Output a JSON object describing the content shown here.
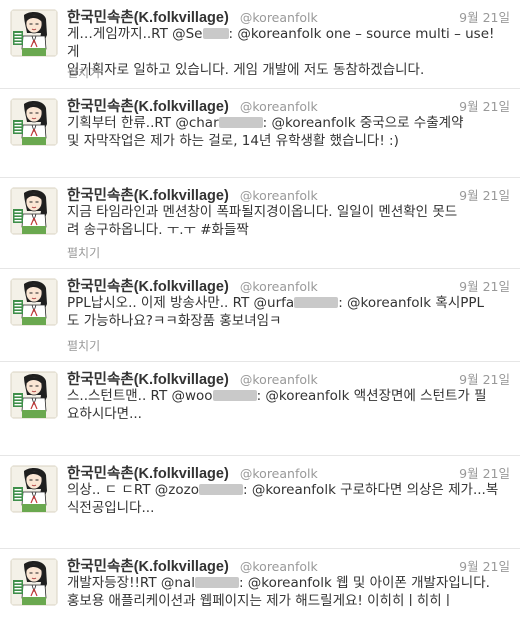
{
  "author": {
    "display_name": "한국민속촌(K.folkvillage)",
    "screen_name": "@koreanfolk",
    "avatar": "folk-village-character-avatar",
    "avatar_text": "한국민속촌"
  },
  "expand_label": "펼치기",
  "colors": {
    "text": "#333333",
    "muted": "#999999",
    "divider": "#e6e6e6",
    "redacted": "#c9c9c9"
  },
  "tweets": [
    {
      "time": "9월 21일",
      "line1": {
        "a": "게…게임까지..RT @Se",
        "b": ": @koreanfolk one – source multi – use! 게"
      },
      "line2": "임기획자로 일하고 있습니다. 게임 개발에 저도 동참하겠습니다."
    },
    {
      "time": "9월 21일",
      "line1": {
        "a": "기획부터 한류..RT @char",
        "b": ": @koreanfolk 중국으로 수출계약"
      },
      "line2": "및 자막작업은 제가 하는 걸로, 14년 유학생활 했습니다! :)"
    },
    {
      "time": "9월 21일",
      "line1": "지금 타임라인과 멘션창이 폭파될지경이옵니다. 일일이 멘션확인 못드",
      "line2": "려 송구하옵니다. ㅜ.ㅜ #화들짝"
    },
    {
      "time": "9월 21일",
      "line1": {
        "a": "PPL납시오.. 이제 방송사만.. RT @urfa",
        "b": ": @koreanfolk 혹시PPL"
      },
      "line2": "도 가능하나요?ㅋㅋ화장품 홍보녀임ㅋ"
    },
    {
      "time": "9월 21일",
      "line1": {
        "a": "스..스턴트맨.. RT @woo",
        "b": ": @koreanfolk 액션장면에 스턴트가 필"
      },
      "line2": "요하시다면..."
    },
    {
      "time": "9월 21일",
      "line1": {
        "a": "의상.. ㄷ ㄷRT @zozo",
        "b": ": @koreanfolk 구로하다면 의상은 제가...복"
      },
      "line2": "식전공입니다..."
    },
    {
      "time": "9월 21일",
      "line1": {
        "a": "개발자등장!!RT @nal",
        "b": ": @koreanfolk 웹 및 아이폰 개발자입니다."
      },
      "line2": "홍보용 애플리케이션과 웹페이지는 제가 해드릴게요! 이히히ㅣ히히ㅣ"
    }
  ]
}
